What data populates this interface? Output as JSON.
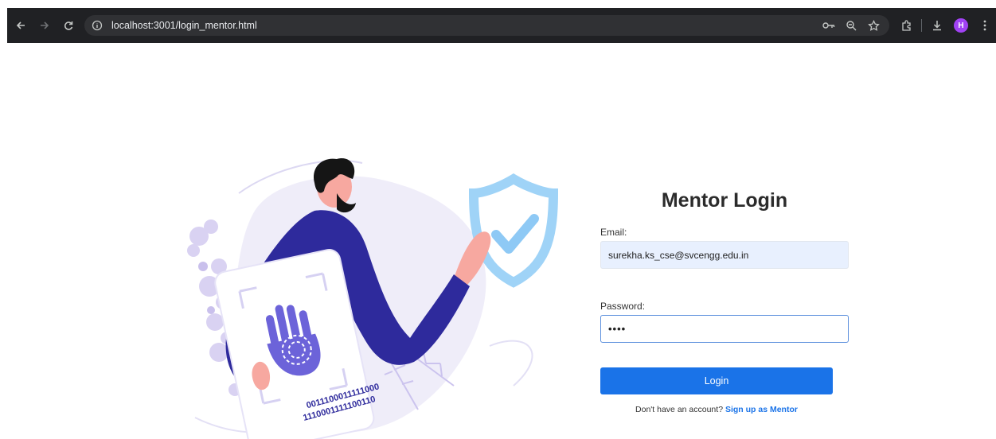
{
  "browser": {
    "url": "localhost:3001/login_mentor.html",
    "profile_initial": "H",
    "icons": [
      "back-arrow-icon",
      "forward-arrow-icon",
      "reload-icon",
      "site-info-icon",
      "password-key-icon",
      "zoom-icon",
      "bookmark-star-icon",
      "extensions-icon",
      "download-icon",
      "profile-avatar",
      "menu-kebab-icon"
    ]
  },
  "illustration": {
    "binary_line_1": "0011100011111000",
    "binary_line_2": "1110001111100110"
  },
  "login": {
    "title": "Mentor Login",
    "email_label": "Email:",
    "email_value": "surekha.ks_cse@svcengg.edu.in",
    "password_label": "Password:",
    "password_value": "••••",
    "button_label": "Login",
    "signup_prompt": "Don't have an account?",
    "signup_link": "Sign up as Mentor"
  },
  "colors": {
    "accent": "#1a73e8",
    "figure_blue": "#2e2a9c",
    "shield_blue": "#8ec9f5",
    "blob_lavender": "#efedf9"
  }
}
